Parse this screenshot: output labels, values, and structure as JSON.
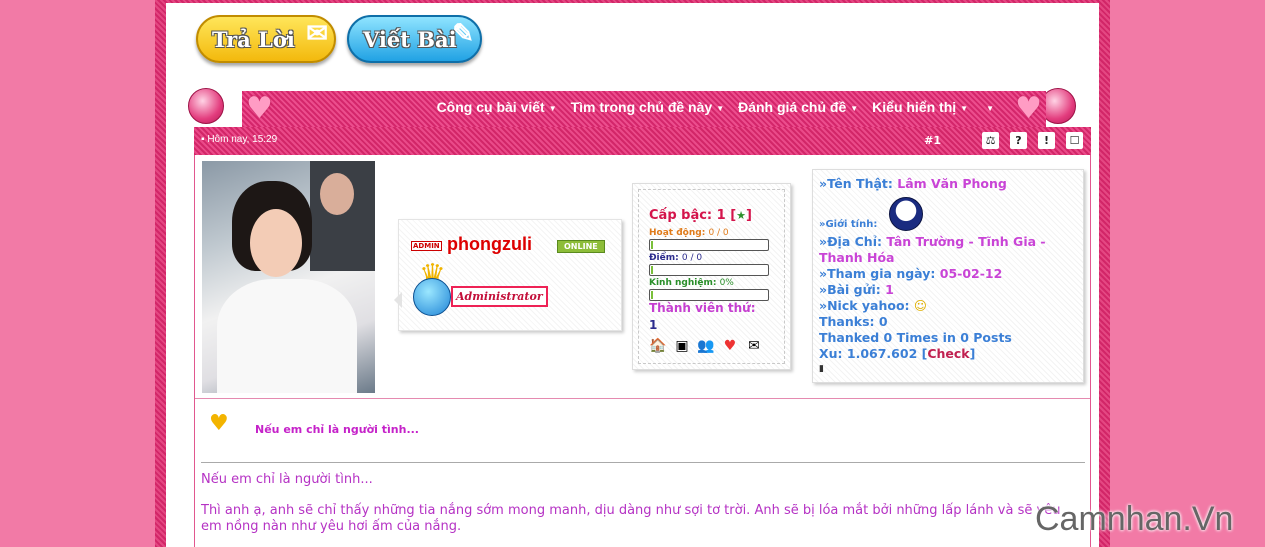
{
  "buttons": {
    "reply_label": "Trả Lời",
    "new_post_label": "Viết Bài"
  },
  "toolbar": {
    "items": [
      "Công cụ bài viết",
      "Tìm trong chủ đề này",
      "Đánh giá chủ đề",
      "Kiểu hiển thị"
    ]
  },
  "post": {
    "date": "Hôm nay, 15:29",
    "number": "#1"
  },
  "user": {
    "admin_tag": "ADMIN",
    "username": "phongzuli",
    "online": "ONLINE",
    "title": "Administrator",
    "rank_label": "Cấp bậc: 1",
    "activity_label": "Hoạt động:",
    "activity_value": "0 / 0",
    "points_label": "Điểm:",
    "points_value": "0 / 0",
    "exp_label": "Kinh nghiệm:",
    "exp_value": "0%",
    "member_label": "Thành viên thứ:",
    "member_number": "1"
  },
  "profile": {
    "realname_label": "»Tên Thật:",
    "realname": "Lâm Văn Phong",
    "gender_label": "»Giới tính:",
    "address_label": "»Địa Chỉ:",
    "address_1": "Tân Trường - Tĩnh Gia -",
    "address_2": "Thanh Hóa",
    "joined_label": "»Tham gia ngày:",
    "joined": "05-02-12",
    "posts_label": "»Bài gửi:",
    "posts": "1",
    "yahoo_label": "»Nick yahoo:",
    "thanks": "Thanks: 0",
    "thanked": "Thanked 0 Times in 0 Posts",
    "xu_label": "Xu: 1.067.602 [",
    "check": "Check",
    "xu_close": "]"
  },
  "content": {
    "title": "Nếu em chỉ là người tình...",
    "line1": "Nếu em chỉ là người tình...",
    "line2": "Thì anh ạ, anh sẽ chỉ thấy những tia nắng sớm mong manh, dịu dàng như sợi tơ trời. Anh sẽ bị lóa mắt bởi những lấp lánh và sẽ yêu em nồng nàn như yêu hơi ấm của nắng."
  },
  "watermark": "Camnhan.Vn"
}
